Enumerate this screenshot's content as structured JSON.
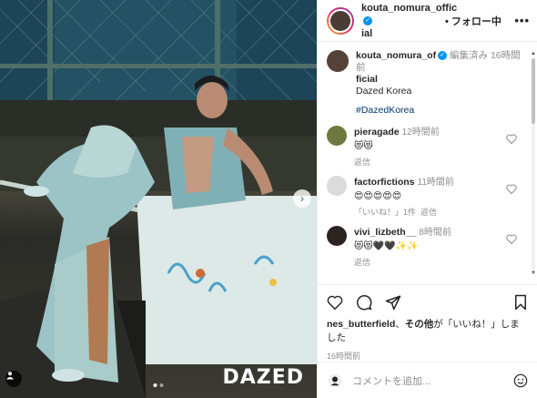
{
  "photo": {
    "watermark": "DAZED",
    "carousel_total": 2,
    "carousel_active": 1
  },
  "header": {
    "username_line1": "kouta_nomura_offic",
    "username_line2": "ial",
    "follow_label": "• フォロー中",
    "more_label": "•••"
  },
  "caption": {
    "username_line1": "kouta_nomura_of",
    "username_line2": "ficial",
    "edited_label": "編集済み",
    "time": "16時間前",
    "text": "Dazed Korea",
    "hashtag": "#DazedKorea"
  },
  "comments": [
    {
      "username": "pieragade",
      "time": "12時間前",
      "text": "😻😻",
      "reply_label": "返信",
      "extra": ""
    },
    {
      "username": "factorfictions",
      "time": "11時間前",
      "text": "😍😍😍😍😍",
      "reply_label": "返信",
      "extra": "「いいね！」1件"
    },
    {
      "username": "vivi_lizbeth__",
      "time": "8時間前",
      "text": "😻😻🖤🖤✨✨",
      "reply_label": "返信",
      "extra": ""
    }
  ],
  "likes": {
    "user": "nes_butterfield",
    "connector": "、",
    "others": "その他",
    "suffix": "が「いいね！」しました"
  },
  "post_time": "16時間前",
  "add_comment": {
    "placeholder": "コメントを追加..."
  },
  "colors": {
    "link": "#00376b",
    "verified": "#0095f6",
    "muted": "#8e8e8e"
  }
}
